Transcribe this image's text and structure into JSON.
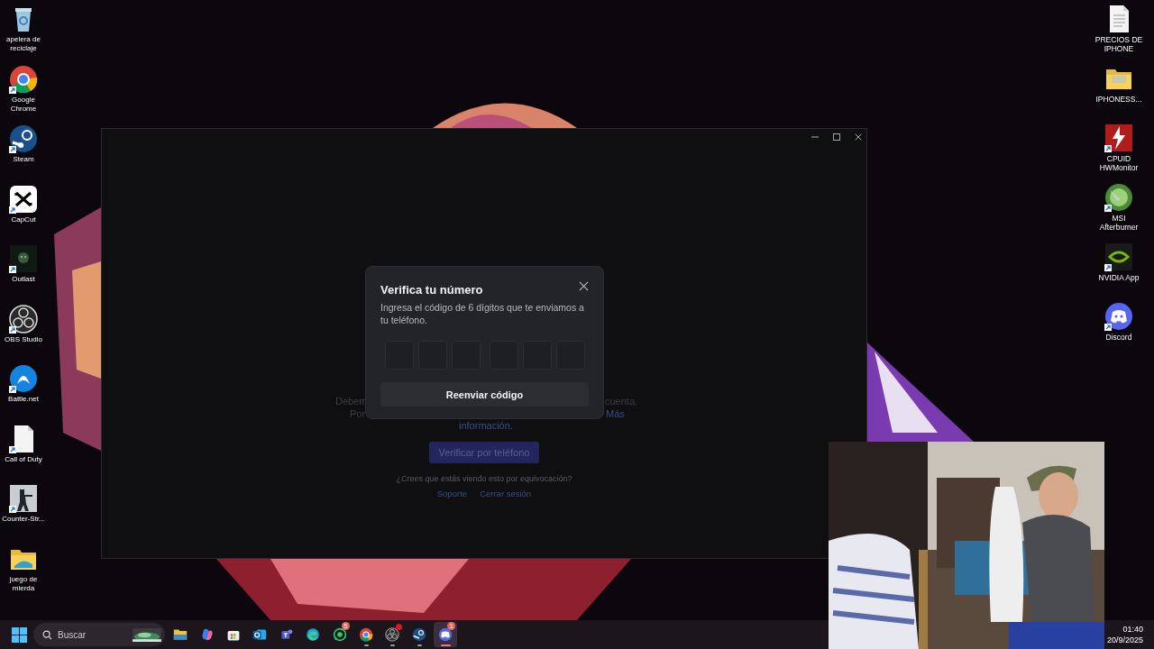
{
  "desktop_icons_left": [
    {
      "label": "apelera de reciclaje",
      "kind": "recycle-bin",
      "shortcut": false
    },
    {
      "label": "Google Chrome",
      "kind": "chrome",
      "shortcut": true
    },
    {
      "label": "Steam",
      "kind": "steam",
      "shortcut": true
    },
    {
      "label": "CapCut",
      "kind": "capcut",
      "shortcut": true
    },
    {
      "label": "Outlast",
      "kind": "dark-tile",
      "shortcut": true
    },
    {
      "label": "OBS Studio",
      "kind": "obs",
      "shortcut": true
    },
    {
      "label": "Battle.net",
      "kind": "battlenet",
      "shortcut": true
    },
    {
      "label": "Call of Duty",
      "kind": "document",
      "shortcut": true
    },
    {
      "label": "Counter-Str...",
      "kind": "soldier",
      "shortcut": true
    },
    {
      "label": "juego de mierda",
      "kind": "folder",
      "shortcut": false
    }
  ],
  "desktop_icons_right": [
    {
      "label": "PRECIOS DE IPHONE",
      "kind": "document",
      "shortcut": false
    },
    {
      "label": "IPHONESS...",
      "kind": "folder",
      "shortcut": false
    },
    {
      "label": "CPUID HWMonitor",
      "kind": "hwmonitor",
      "shortcut": true
    },
    {
      "label": "MSI Afterburner",
      "kind": "afterburner",
      "shortcut": true
    },
    {
      "label": "NVIDIA App",
      "kind": "nvidia",
      "shortcut": true
    },
    {
      "label": "Discord",
      "kind": "discord",
      "shortcut": true
    }
  ],
  "app_window": {
    "line_1_left": "Debem",
    "line_1_right": "cuenta.",
    "line_2_left": "Por",
    "line_2_right_link": "Más",
    "line_3_link": "información.",
    "verify_button": "Verificar por teléfono",
    "mistake_prompt": "¿Crees que estás viendo esto por equivocación?",
    "links": [
      "Soporte",
      "Cerrar sesión"
    ]
  },
  "modal": {
    "title": "Verifica tu número",
    "description": "Ingresa el código de 6 dígitos que te enviamos a tu teléfono.",
    "code_boxes": [
      {
        "filled": false
      },
      {
        "filled": false
      },
      {
        "filled": false
      },
      {
        "filled": false
      },
      {
        "filled": false
      },
      {
        "filled": false
      }
    ],
    "resend_button": "Reenviar código"
  },
  "taskbar": {
    "search_placeholder": "Buscar",
    "apps": [
      {
        "kind": "folder",
        "running": false,
        "selected": false,
        "alert": false
      },
      {
        "kind": "copilot",
        "running": false,
        "selected": false,
        "alert": false
      },
      {
        "kind": "store",
        "running": false,
        "selected": false,
        "alert": false
      },
      {
        "kind": "outlook",
        "running": false,
        "selected": false,
        "alert": false
      },
      {
        "kind": "teams",
        "running": false,
        "selected": false,
        "alert": false
      },
      {
        "kind": "edge",
        "running": false,
        "selected": false,
        "alert": false
      },
      {
        "kind": "whatsapp",
        "running": false,
        "selected": false,
        "alert": false,
        "badge": "5"
      },
      {
        "kind": "chrome",
        "running": true,
        "selected": false,
        "alert": false
      },
      {
        "kind": "obs",
        "running": true,
        "selected": false,
        "alert": true
      },
      {
        "kind": "steam",
        "running": true,
        "selected": false,
        "alert": false
      },
      {
        "kind": "discord",
        "running": true,
        "selected": true,
        "alert": false,
        "badge": "1"
      }
    ],
    "time": "01:40",
    "date": "20/9/2025"
  }
}
